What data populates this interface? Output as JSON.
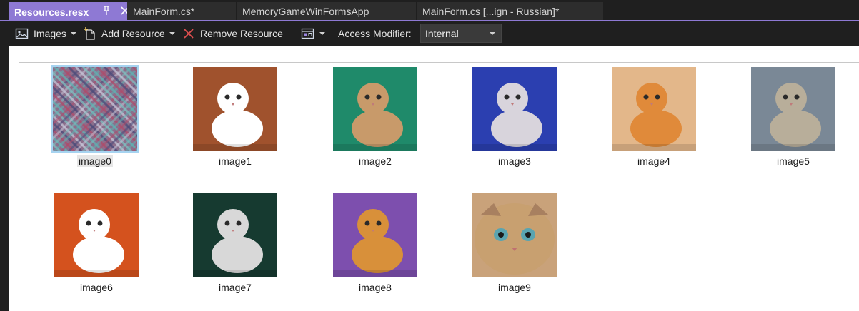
{
  "tabs": [
    {
      "label": "Resources.resx",
      "active": true
    },
    {
      "label": "MainForm.cs*",
      "active": false
    },
    {
      "label": "MemoryGameWinFormsApp",
      "active": false
    },
    {
      "label": "MainForm.cs [...ign - Russian]*",
      "active": false
    }
  ],
  "toolbar": {
    "images_label": "Images",
    "add_resource_label": "Add Resource",
    "remove_resource_label": "Remove Resource",
    "access_modifier_label": "Access Modifier:",
    "access_modifier_value": "Internal"
  },
  "resources": [
    {
      "name": "image0",
      "selected": true,
      "bg": "#7a6f8a"
    },
    {
      "name": "image1",
      "selected": false,
      "bg": "#a0522d"
    },
    {
      "name": "image2",
      "selected": false,
      "bg": "#1f8a6a"
    },
    {
      "name": "image3",
      "selected": false,
      "bg": "#2b3fb0"
    },
    {
      "name": "image4",
      "selected": false,
      "bg": "#e3b78a"
    },
    {
      "name": "image5",
      "selected": false,
      "bg": "#7a8896"
    },
    {
      "name": "image6",
      "selected": false,
      "bg": "#d4521e"
    },
    {
      "name": "image7",
      "selected": false,
      "bg": "#163a30"
    },
    {
      "name": "image8",
      "selected": false,
      "bg": "#7d4fae"
    },
    {
      "name": "image9",
      "selected": false,
      "bg": "#c9a27a"
    }
  ],
  "colors": {
    "accent": "#8e79d4",
    "background": "#1f1f1f",
    "canvas": "#ffffff",
    "selection": "#a6d3f0"
  }
}
